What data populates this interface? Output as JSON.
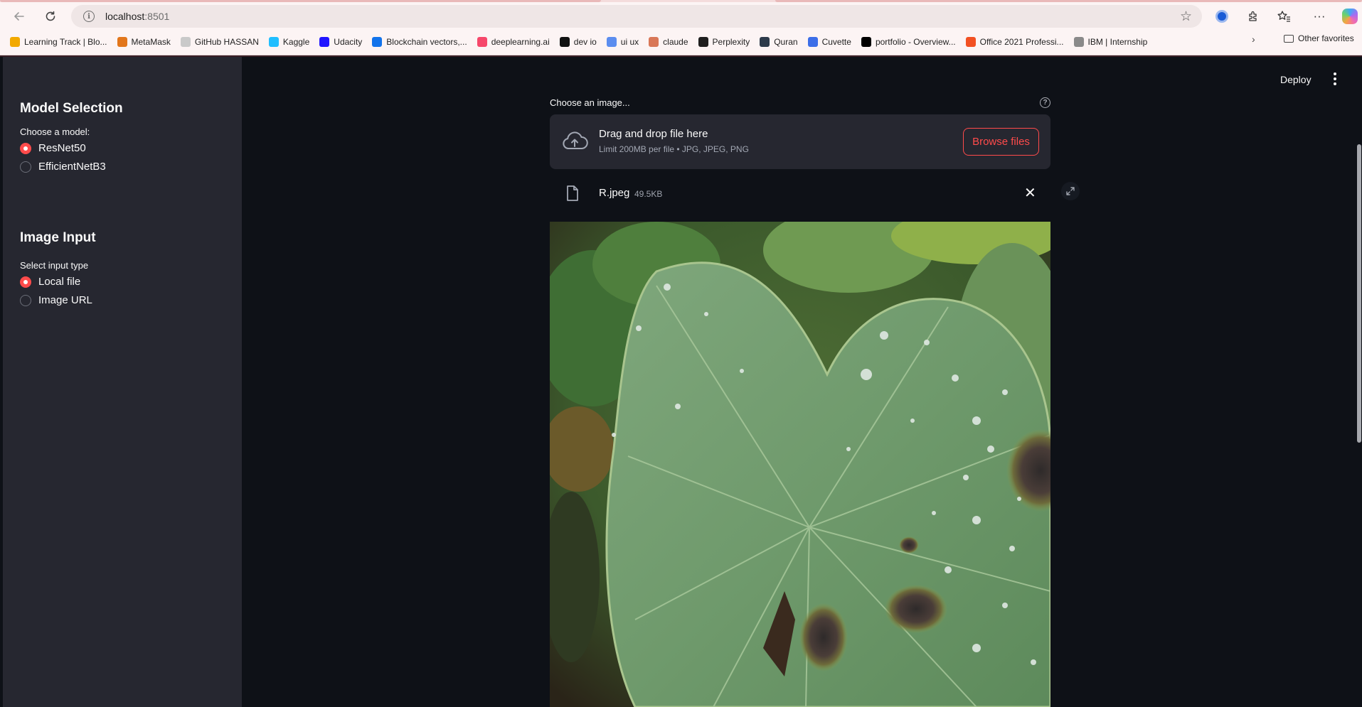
{
  "browser": {
    "url_host": "localhost",
    "url_port": ":8501",
    "bookmarks": [
      {
        "label": "Learning Track | Blo...",
        "icon": "bar-chart-icon",
        "color": "#f2a900"
      },
      {
        "label": "MetaMask",
        "icon": "metamask-fox-icon",
        "color": "#e2761b"
      },
      {
        "label": "GitHub HASSAN",
        "icon": "github-icon",
        "color": "#c9c9c9"
      },
      {
        "label": "Kaggle",
        "icon": "kaggle-icon",
        "color": "#20beff"
      },
      {
        "label": "Udacity",
        "icon": "udacity-icon",
        "color": "#2015ff"
      },
      {
        "label": "Blockchain vectors,...",
        "icon": "freepik-icon",
        "color": "#1273eb"
      },
      {
        "label": "deeplearning.ai",
        "icon": "deeplearning-icon",
        "color": "#f6476a"
      },
      {
        "label": "dev io",
        "icon": "devio-icon",
        "color": "#111111"
      },
      {
        "label": "ui ux",
        "icon": "uiux-icon",
        "color": "#5b8def"
      },
      {
        "label": "claude",
        "icon": "claude-icon",
        "color": "#d97757"
      },
      {
        "label": "Perplexity",
        "icon": "perplexity-icon",
        "color": "#1f1f1f"
      },
      {
        "label": "Quran",
        "icon": "quran-icon",
        "color": "#2d3a4a"
      },
      {
        "label": "Cuvette",
        "icon": "cuvette-icon",
        "color": "#3c6ee8"
      },
      {
        "label": "portfolio - Overview...",
        "icon": "vercel-icon",
        "color": "#000000"
      },
      {
        "label": "Office 2021 Professi...",
        "icon": "windows-icon",
        "color": "#f25022"
      },
      {
        "label": "IBM | Internship",
        "icon": "ibm-icon",
        "color": "#8a8a8a"
      }
    ],
    "other_favorites": "Other favorites"
  },
  "header": {
    "deploy_label": "Deploy"
  },
  "sidebar": {
    "model_section": {
      "title": "Model Selection",
      "prompt": "Choose a model:",
      "options": [
        {
          "label": "ResNet50",
          "selected": true
        },
        {
          "label": "EfficientNetB3",
          "selected": false
        }
      ]
    },
    "input_section": {
      "title": "Image Input",
      "prompt": "Select input type",
      "options": [
        {
          "label": "Local file",
          "selected": true
        },
        {
          "label": "Image URL",
          "selected": false
        }
      ]
    }
  },
  "uploader": {
    "label": "Choose an image...",
    "drop_title": "Drag and drop file here",
    "drop_subtitle": "Limit 200MB per file • JPG, JPEG, PNG",
    "browse_label": "Browse files",
    "file": {
      "name": "R.jpeg",
      "size": "49.5KB"
    }
  },
  "colors": {
    "accent": "#ff4b4b",
    "background": "#0e1117",
    "sidebar": "#262730"
  }
}
